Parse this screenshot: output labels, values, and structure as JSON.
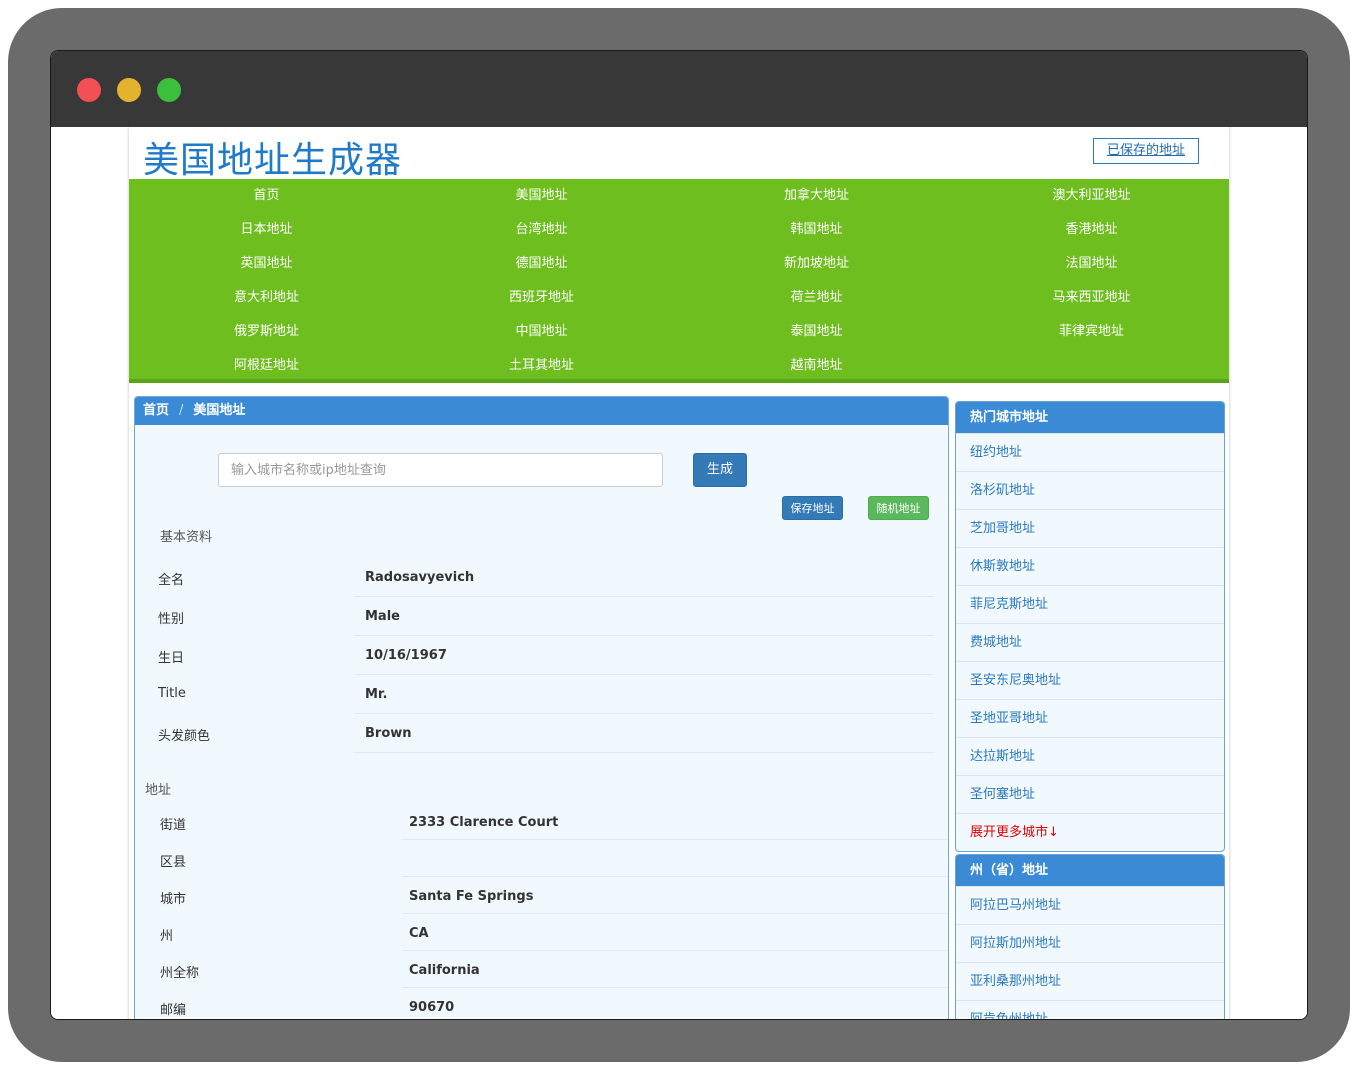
{
  "site": {
    "title": "美国地址生成器",
    "saved_link": "已保存的地址"
  },
  "nav": [
    "首页",
    "美国地址",
    "加拿大地址",
    "澳大利亚地址",
    "日本地址",
    "台湾地址",
    "韩国地址",
    "香港地址",
    "英国地址",
    "德国地址",
    "新加坡地址",
    "法国地址",
    "意大利地址",
    "西班牙地址",
    "荷兰地址",
    "马来西亚地址",
    "俄罗斯地址",
    "中国地址",
    "泰国地址",
    "菲律宾地址",
    "阿根廷地址",
    "土耳其地址",
    "越南地址"
  ],
  "breadcrumb": {
    "home": "首页",
    "separator": "/",
    "current": "美国地址"
  },
  "search": {
    "placeholder": "输入城市名称或ip地址查询",
    "value": ""
  },
  "buttons": {
    "generate": "生成",
    "save": "保存地址",
    "random": "随机地址"
  },
  "basic": {
    "heading": "基本资料",
    "rows": [
      {
        "label": "全名",
        "value": "Radosavyevich"
      },
      {
        "label": "性别",
        "value": "Male"
      },
      {
        "label": "生日",
        "value": "10/16/1967"
      },
      {
        "label": "Title",
        "value": "Mr."
      },
      {
        "label": "头发颜色",
        "value": "Brown"
      }
    ]
  },
  "address": {
    "heading": "地址",
    "rows": [
      {
        "label": "街道",
        "value": "2333  Clarence Court"
      },
      {
        "label": "区县",
        "value": ""
      },
      {
        "label": "城市",
        "value": "Santa Fe Springs"
      },
      {
        "label": "州",
        "value": "CA"
      },
      {
        "label": "州全称",
        "value": "California"
      },
      {
        "label": "邮编",
        "value": "90670"
      }
    ]
  },
  "hot_cities": {
    "heading": "热门城市地址",
    "items": [
      "纽约地址",
      "洛杉矶地址",
      "芝加哥地址",
      "休斯敦地址",
      "菲尼克斯地址",
      "费城地址",
      "圣安东尼奥地址",
      "圣地亚哥地址",
      "达拉斯地址",
      "圣何塞地址"
    ],
    "more": "展开更多城市↓"
  },
  "states": {
    "heading": "州（省）地址",
    "items": [
      "阿拉巴马州地址",
      "阿拉斯加州地址",
      "亚利桑那州地址",
      "阿肯色州地址"
    ]
  },
  "colors": {
    "nav_green": "#6dbe1e",
    "header_blue": "#3a8ad6",
    "link_blue": "#2a7ac0",
    "more_red": "#e00000"
  }
}
